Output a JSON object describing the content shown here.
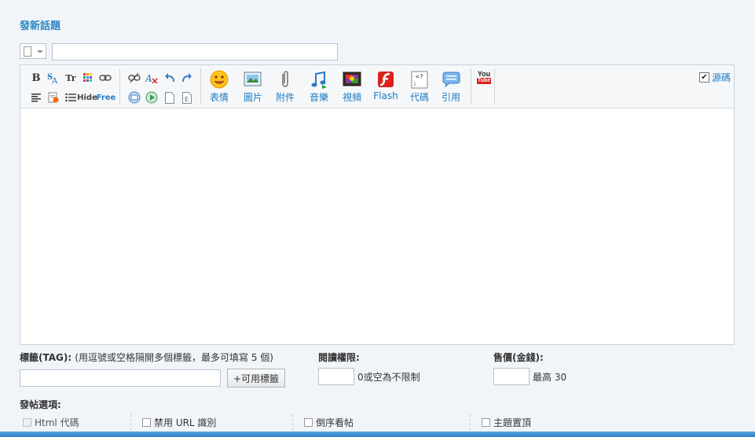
{
  "page": {
    "title": "發新話題"
  },
  "subject": {
    "value": ""
  },
  "toolbar": {
    "small_icons": [
      "bold-icon",
      "font-icon",
      "text-size-icon",
      "color-icon",
      "link-icon",
      "unlink-icon",
      "remove-format-icon",
      "undo-icon",
      "redo-icon",
      "align-left-icon",
      "paste-icon",
      "list-icon",
      "hide-icon",
      "free-icon",
      "insert-icon",
      "media-icon",
      "page-icon",
      "index-icon"
    ],
    "hide_label": "Hide",
    "free_label": "Free",
    "big_buttons": [
      {
        "label": "表情",
        "icon": "smiley-icon"
      },
      {
        "label": "圖片",
        "icon": "image-icon"
      },
      {
        "label": "附件",
        "icon": "paperclip-icon"
      },
      {
        "label": "音樂",
        "icon": "music-icon"
      },
      {
        "label": "視頻",
        "icon": "video-icon"
      },
      {
        "label": "Flash",
        "icon": "flash-icon"
      },
      {
        "label": "代碼",
        "icon": "code-icon"
      },
      {
        "label": "引用",
        "icon": "quote-icon"
      }
    ],
    "youtube_label_top": "You",
    "youtube_label_bottom": "Tube",
    "source_label": "源碼",
    "source_checked": true
  },
  "tags": {
    "label": "標籤(TAG):",
    "hint": "(用逗號或空格隔開多個標籤，最多可填寫 5 個)",
    "value": "",
    "button": "+可用標籤"
  },
  "read_permission": {
    "label": "閱讀權限:",
    "value": "",
    "hint": "0或空為不限制"
  },
  "price": {
    "label": "售價(金錢):",
    "value": "",
    "hint": "最高 30"
  },
  "options": {
    "label": "發帖選項:",
    "items": [
      {
        "label": "Html 代碼",
        "checked": false,
        "disabled": true
      },
      {
        "label": "禁用 URL 識別",
        "checked": false,
        "disabled": false
      },
      {
        "label": "倒序看帖",
        "checked": false,
        "disabled": false
      },
      {
        "label": "主題置頂",
        "checked": false,
        "disabled": false
      }
    ]
  }
}
